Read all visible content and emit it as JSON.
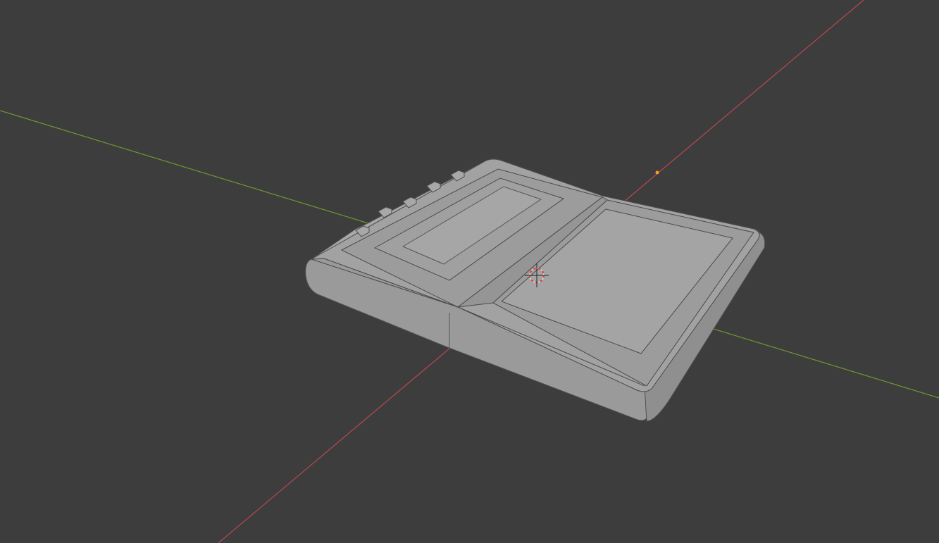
{
  "viewport": {
    "background_color": "#3d3d3d",
    "x_axis_color": "#b8494f",
    "y_axis_color": "#6c9a2e",
    "mesh_color": "#a3a3a3",
    "mesh_edge_color": "#4a4a4a",
    "origin_dot_color": "#f0a020",
    "cursor_color": "#e04040"
  },
  "scene": {
    "object_name": "",
    "view_mode": "Object"
  }
}
